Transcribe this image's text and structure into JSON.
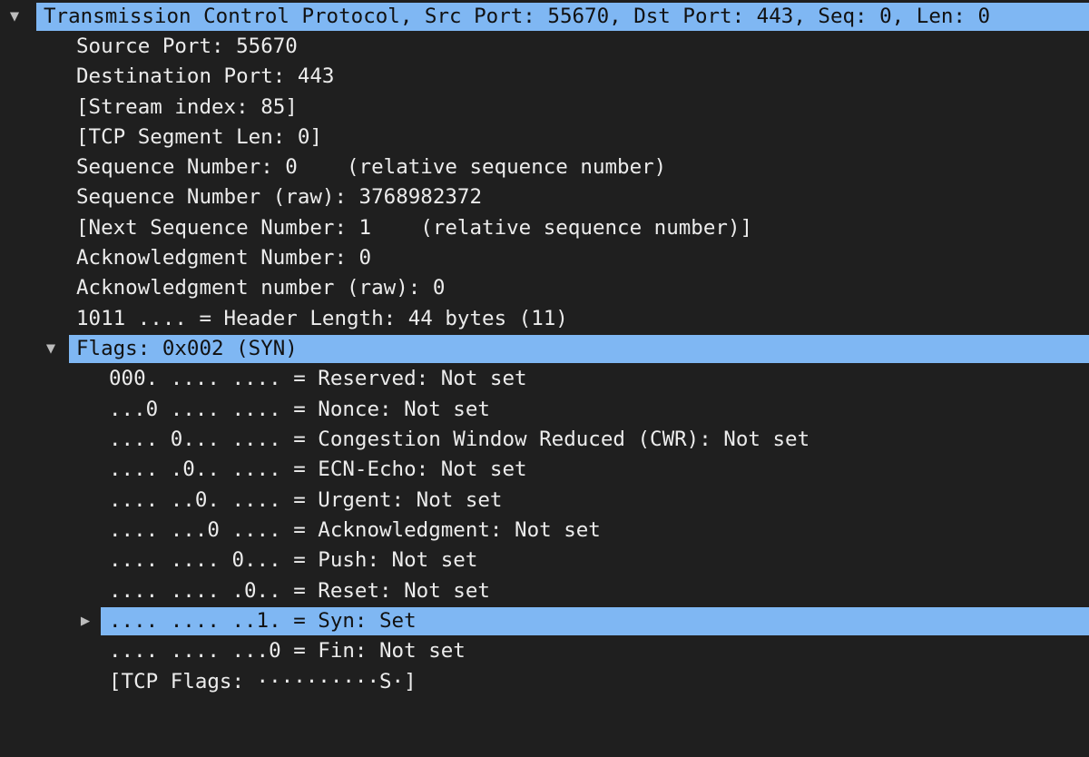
{
  "tcp": {
    "summary": "Transmission Control Protocol, Src Port: 55670, Dst Port: 443, Seq: 0, Len: 0",
    "fields": [
      "Source Port: 55670",
      "Destination Port: 443",
      "[Stream index: 85]",
      "[TCP Segment Len: 0]",
      "Sequence Number: 0    (relative sequence number)",
      "Sequence Number (raw): 3768982372",
      "[Next Sequence Number: 1    (relative sequence number)]",
      "Acknowledgment Number: 0",
      "Acknowledgment number (raw): 0",
      "1011 .... = Header Length: 44 bytes (11)"
    ],
    "flags": {
      "summary": "Flags: 0x002 (SYN)",
      "bits": [
        "000. .... .... = Reserved: Not set",
        "...0 .... .... = Nonce: Not set",
        ".... 0... .... = Congestion Window Reduced (CWR): Not set",
        ".... .0.. .... = ECN-Echo: Not set",
        ".... ..0. .... = Urgent: Not set",
        ".... ...0 .... = Acknowledgment: Not set",
        ".... .... 0... = Push: Not set",
        ".... .... .0.. = Reset: Not set",
        ".... .... ..1. = Syn: Set",
        ".... .... ...0 = Fin: Not set"
      ],
      "tcp_flags": "[TCP Flags: ··········S·]"
    }
  },
  "icons": {
    "expanded": "▼",
    "collapsed": "▶"
  },
  "colors": {
    "background": "#1f1f1f",
    "selection": "#7fb7f3",
    "text": "#ececec",
    "selected_text": "#111111"
  }
}
